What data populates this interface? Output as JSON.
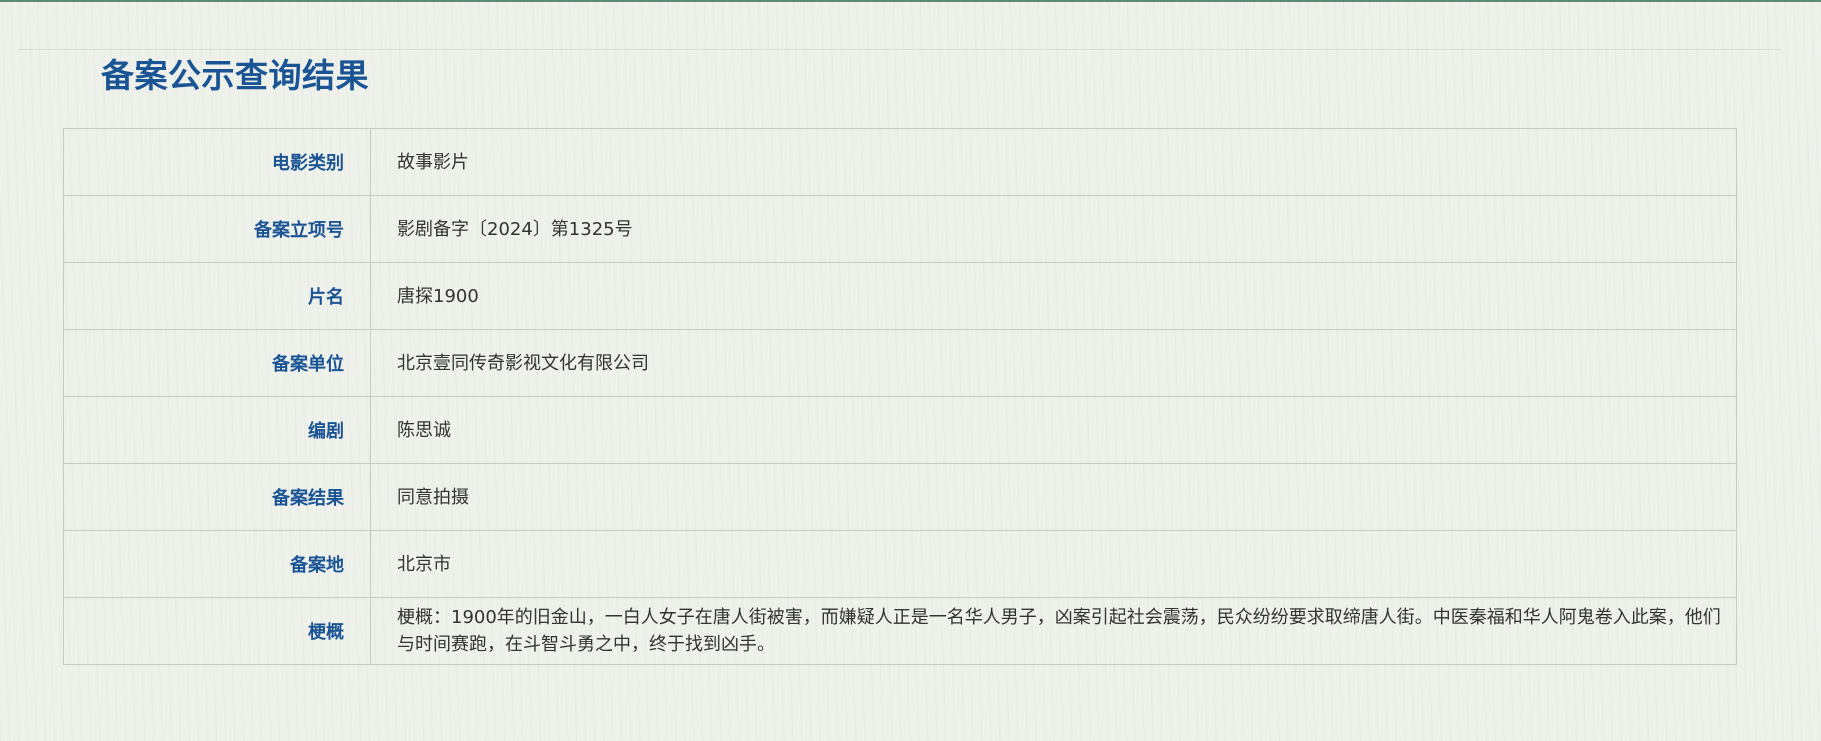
{
  "page": {
    "title": "备案公示查询结果"
  },
  "rows": [
    {
      "label": "电影类别",
      "value": "故事影片"
    },
    {
      "label": "备案立项号",
      "value": "影剧备字〔2024〕第1325号"
    },
    {
      "label": "片名",
      "value": "唐探1900"
    },
    {
      "label": "备案单位",
      "value": "北京壹同传奇影视文化有限公司"
    },
    {
      "label": "编剧",
      "value": "陈思诚"
    },
    {
      "label": "备案结果",
      "value": "同意拍摄"
    },
    {
      "label": "备案地",
      "value": "北京市"
    },
    {
      "label": "梗概",
      "value": "梗概：1900年的旧金山，一白人女子在唐人街被害，而嫌疑人正是一名华人男子，凶案引起社会震荡，民众纷纷要求取缔唐人街。中医秦福和华人阿鬼卷入此案，他们与时间赛跑，在斗智斗勇之中，终于找到凶手。"
    }
  ],
  "colors": {
    "accent": "#1a5494",
    "top_bar": "#5f8a78",
    "background": "#eef0ea",
    "border": "#c8cac3",
    "text": "#333333"
  }
}
